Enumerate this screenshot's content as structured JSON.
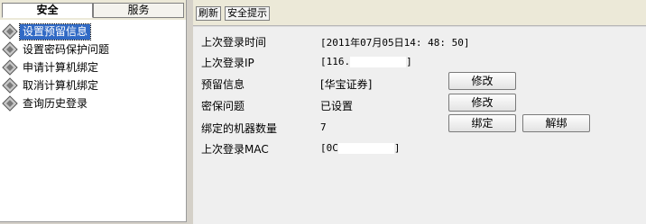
{
  "tabs": {
    "security": "安全",
    "service": "服务"
  },
  "menu": [
    {
      "label": "设置预留信息",
      "selected": true
    },
    {
      "label": "设置密码保护问题"
    },
    {
      "label": "申请计算机绑定"
    },
    {
      "label": "取消计算机绑定"
    },
    {
      "label": "查询历史登录"
    }
  ],
  "toolbar": {
    "refresh": "刷新",
    "security_tip": "安全提示"
  },
  "info": {
    "last_login_time_label": "上次登录时间",
    "last_login_time_value": "[2011年07月05日14: 48: 50]",
    "last_login_ip_label": "上次登录IP",
    "last_login_ip_prefix": "[116.",
    "last_login_ip_suffix": "]",
    "reserved_info_label": "预留信息",
    "reserved_info_value": "[华宝证券]",
    "security_question_label": "密保问题",
    "security_question_value": "已设置",
    "bound_machines_label": "绑定的机器数量",
    "bound_machines_value": "7",
    "last_login_mac_label": "上次登录MAC",
    "last_login_mac_prefix": "[0C",
    "last_login_mac_suffix": "]"
  },
  "buttons": {
    "modify_reserved": "修改",
    "modify_question": "修改",
    "bind": "绑定",
    "unbind": "解绑"
  },
  "icons": {
    "menu_item": "diamond-arrows-icon"
  }
}
